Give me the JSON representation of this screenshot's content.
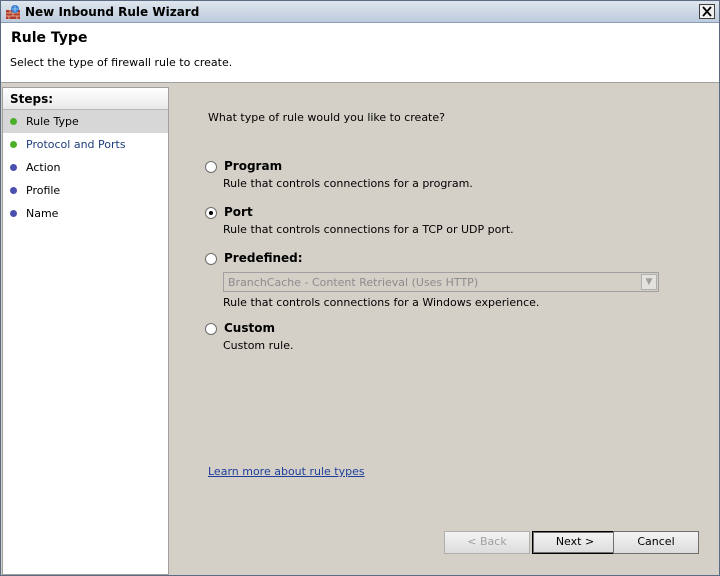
{
  "window": {
    "title": "New Inbound Rule Wizard",
    "close_icon": "close-icon"
  },
  "header": {
    "title": "Rule Type",
    "subtitle": "Select the type of firewall rule to create."
  },
  "steps": {
    "heading": "Steps:",
    "items": [
      {
        "label": "Rule Type",
        "status": "done",
        "active": true
      },
      {
        "label": "Protocol and Ports",
        "status": "done",
        "active": false
      },
      {
        "label": "Action",
        "status": "pending",
        "active": false
      },
      {
        "label": "Profile",
        "status": "pending",
        "active": false
      },
      {
        "label": "Name",
        "status": "pending",
        "active": false
      }
    ],
    "colors": {
      "done": "#4caf2a",
      "pending": "#4a4fb0"
    }
  },
  "main": {
    "question": "What type of rule would you like to create?",
    "options": [
      {
        "label": "Program",
        "description": "Rule that controls connections for a program.",
        "selected": false
      },
      {
        "label": "Port",
        "description": "Rule that controls connections for a TCP or UDP port.",
        "selected": true
      },
      {
        "label": "Predefined:",
        "description": "Rule that controls connections for a Windows experience.",
        "selected": false
      },
      {
        "label": "Custom",
        "description": "Custom rule.",
        "selected": false
      }
    ],
    "predefined_select": {
      "value": "BranchCache - Content Retrieval (Uses HTTP)",
      "disabled": true
    },
    "learn_more": "Learn more about rule types"
  },
  "buttons": {
    "back": "< Back",
    "next": "Next >",
    "cancel": "Cancel"
  }
}
